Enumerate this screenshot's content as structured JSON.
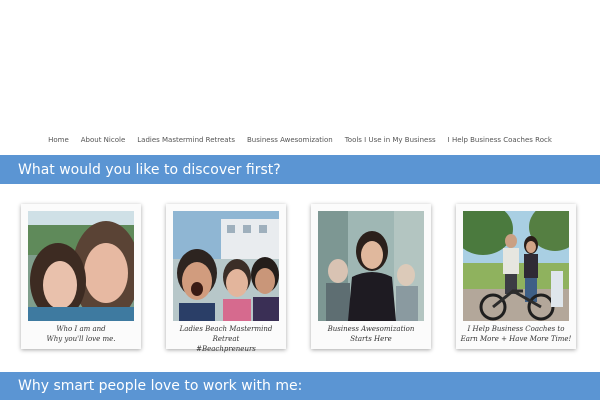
{
  "nav": {
    "items": [
      {
        "label": "Home"
      },
      {
        "label": "About Nicole"
      },
      {
        "label": "Ladies Mastermind Retreats"
      },
      {
        "label": "Business Awesomization"
      },
      {
        "label": "Tools I Use in My Business"
      },
      {
        "label": "I Help Business Coaches Rock"
      }
    ]
  },
  "section1": {
    "heading": "What would you like to discover first?"
  },
  "cards": [
    {
      "caption": "Who I am and\nWhy you'll love me."
    },
    {
      "caption": "Ladies Beach Mastermind Retreat\n#Beachpreneurs"
    },
    {
      "caption": "Business Awesomization\nStarts Here"
    },
    {
      "caption": "I Help Business Coaches to\nEarn More + Have More Time!"
    }
  ],
  "section2": {
    "heading": "Why smart people love to work with me:"
  },
  "colors": {
    "band": "#5b95d3"
  }
}
